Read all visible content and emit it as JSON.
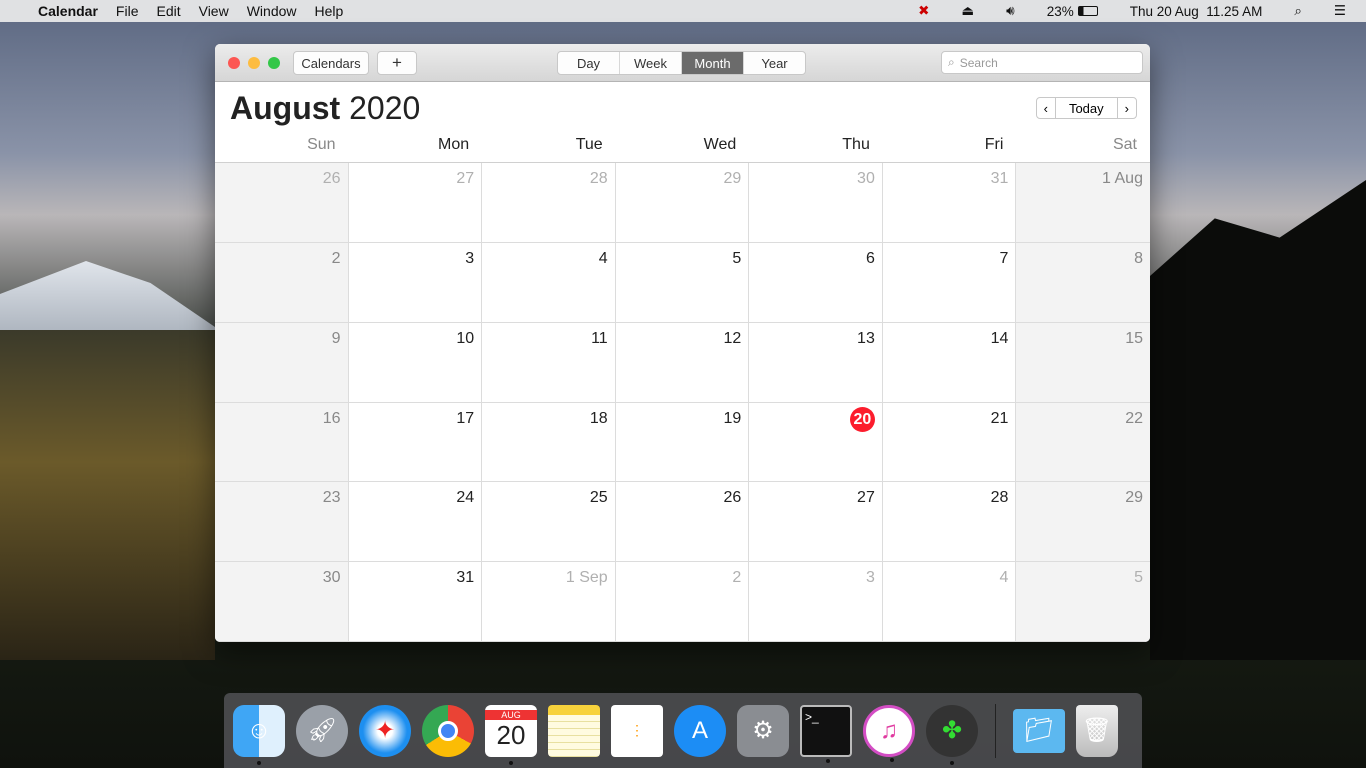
{
  "menubar": {
    "app": "Calendar",
    "items": [
      "File",
      "Edit",
      "View",
      "Window",
      "Help"
    ],
    "battery": "23%",
    "datetime": "Thu 20 Aug  11.25 AM"
  },
  "toolbar": {
    "calendars": "Calendars",
    "add": "+",
    "views": [
      "Day",
      "Week",
      "Month",
      "Year"
    ],
    "active_view": "Month",
    "search_placeholder": "Search"
  },
  "header": {
    "month": "August",
    "year": "2020",
    "today": "Today",
    "prev": "‹",
    "next": "›"
  },
  "weekdays": [
    "Sun",
    "Mon",
    "Tue",
    "Wed",
    "Thu",
    "Fri",
    "Sat"
  ],
  "weeks": [
    [
      "26",
      "27",
      "28",
      "29",
      "30",
      "31",
      "1 Aug"
    ],
    [
      "2",
      "3",
      "4",
      "5",
      "6",
      "7",
      "8"
    ],
    [
      "9",
      "10",
      "11",
      "12",
      "13",
      "14",
      "15"
    ],
    [
      "16",
      "17",
      "18",
      "19",
      "20",
      "21",
      "22"
    ],
    [
      "23",
      "24",
      "25",
      "26",
      "27",
      "28",
      "29"
    ],
    [
      "30",
      "31",
      "1 Sep",
      "2",
      "3",
      "4",
      "5"
    ]
  ],
  "today_label": "20",
  "accent": "#fc1d2d",
  "dock": {
    "calendar_month": "AUG",
    "calendar_day": "20",
    "items": [
      "finder",
      "launchpad",
      "safari",
      "chrome",
      "calendar",
      "notes",
      "reminders",
      "app-store",
      "system-preferences",
      "terminal",
      "itunes",
      "clover",
      "folder",
      "trash"
    ]
  }
}
